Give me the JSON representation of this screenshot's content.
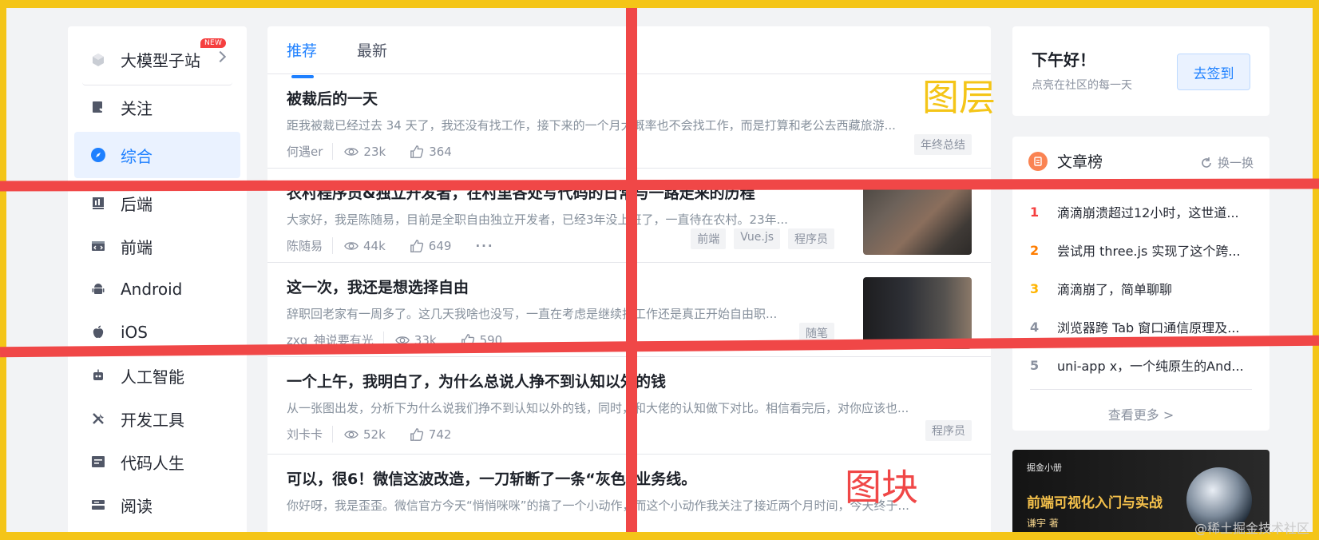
{
  "sidebar": {
    "items": [
      {
        "label": "大模型子站",
        "badge": "NEW",
        "icon": "cube-icon"
      },
      {
        "label": "关注",
        "icon": "follow-icon"
      },
      {
        "label": "综合",
        "icon": "compass-icon",
        "active": true
      },
      {
        "label": "后端",
        "icon": "backend-icon"
      },
      {
        "label": "前端",
        "icon": "frontend-icon"
      },
      {
        "label": "Android",
        "icon": "android-icon"
      },
      {
        "label": "iOS",
        "icon": "apple-icon"
      },
      {
        "label": "人工智能",
        "icon": "robot-icon"
      },
      {
        "label": "开发工具",
        "icon": "tools-icon"
      },
      {
        "label": "代码人生",
        "icon": "code-life-icon"
      },
      {
        "label": "阅读",
        "icon": "read-icon"
      }
    ]
  },
  "feed": {
    "tabs": [
      {
        "label": "推荐"
      },
      {
        "label": "最新"
      }
    ],
    "articles": [
      {
        "title": "被裁后的一天",
        "desc": "距我被裁已经过去 34 天了，我还没有找工作，接下来的一个月大概率也不会找工作，而是打算和老公去西藏旅游...",
        "author": "何遇er",
        "views": "23k",
        "likes": "364",
        "tags": [
          "年终总结"
        ]
      },
      {
        "title": "农村程序员&独立开发者，在村里各处写代码的日常与一路走来的历程",
        "desc": "大家好，我是陈随易，目前是全职自由独立开发者，已经3年没上班了，一直待在农村。23年...",
        "author": "陈随易",
        "views": "44k",
        "likes": "649",
        "more": "···",
        "tags": [
          "前端",
          "Vue.js",
          "程序员"
        ]
      },
      {
        "title": "这一次，我还是想选择自由",
        "desc": "辞职回老家有一周多了。这几天我啥也没写，一直在考虑是继续找工作还是真正开始自由职...",
        "author": "zxg_神说要有光",
        "views": "33k",
        "likes": "590",
        "tags": [
          "随笔"
        ]
      },
      {
        "title": "一个上午，我明白了，为什么总说人挣不到认知以外的钱",
        "desc": "从一张图出发，分析下为什么说我们挣不到认知以外的钱，同时，和大佬的认知做下对比。相信看完后，对你应该也...",
        "author": "刘卡卡",
        "views": "52k",
        "likes": "742",
        "tags": [
          "程序员"
        ]
      },
      {
        "title": "可以，很6！微信这波改造，一刀斩断了一条“灰色”业务线。",
        "desc": "你好呀，我是歪歪。微信官方今天“悄悄咪咪”的搞了一个小动作，而这个小动作我关注了接近两个月时间，今天终于...",
        "author": "",
        "views": "",
        "likes": "",
        "tags": []
      }
    ]
  },
  "greeting": {
    "title": "下午好！",
    "subtitle": "点亮在社区的每一天",
    "button": "去签到"
  },
  "ranking": {
    "title": "文章榜",
    "refresh": "换一换",
    "items": [
      {
        "no": "1",
        "text": "滴滴崩溃超过12小时，这世道...",
        "color": "#f53f3f"
      },
      {
        "no": "2",
        "text": "尝试用 three.js 实现了这个跨...",
        "color": "#ff7d00"
      },
      {
        "no": "3",
        "text": "滴滴崩了，简单聊聊",
        "color": "#ffb400"
      },
      {
        "no": "4",
        "text": "浏览器跨 Tab 窗口通信原理及...",
        "color": "#8a919f"
      },
      {
        "no": "5",
        "text": "uni-app x，一个纯原生的And...",
        "color": "#8a919f"
      }
    ],
    "more": "查看更多 >"
  },
  "book": {
    "brand": "掘金小册",
    "title": "前端可视化入门与实战",
    "author": "谦宇 著"
  },
  "annotations": {
    "layer": "图层",
    "block": "图块"
  },
  "watermark": "@稀土掘金技术社区",
  "colors": {
    "accent": "#1e80ff",
    "annotation": "#f04747",
    "border": "#f4c518"
  }
}
